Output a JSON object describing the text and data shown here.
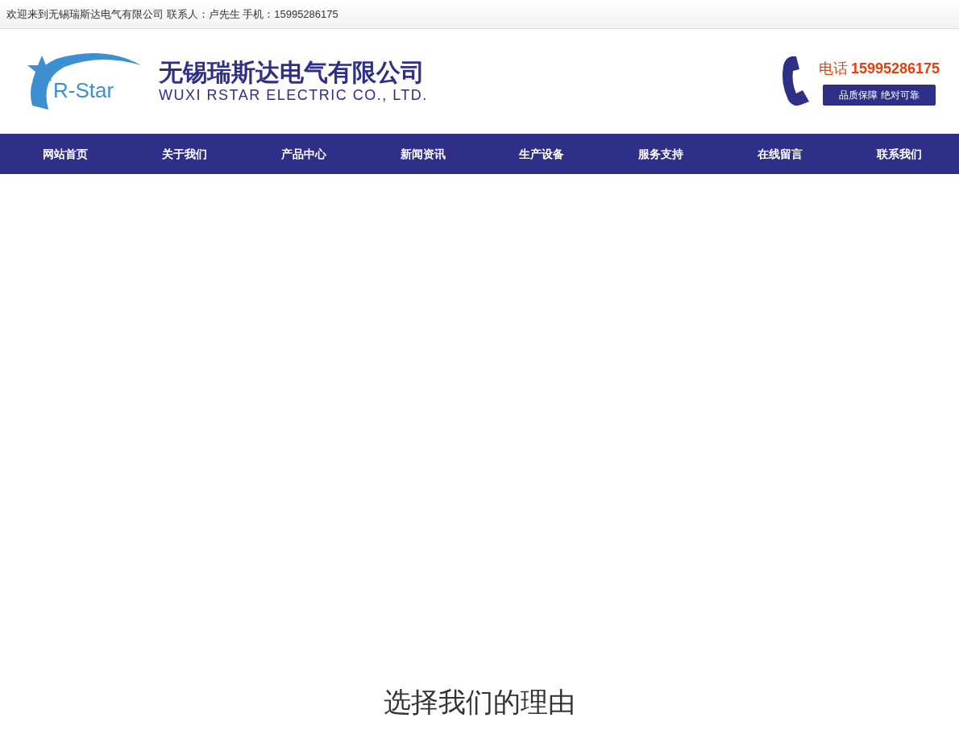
{
  "top_bar": {
    "text": "欢迎来到无锡瑞斯达电气有限公司 联系人：卢先生 手机：15995286175"
  },
  "header": {
    "logo_text": "R-Star",
    "company_name": "无锡瑞斯达电气有限公司",
    "company_name_en": "WUXI RSTAR ELECTRIC CO., LTD.",
    "phone_label": "电话",
    "phone_number": "15995286175",
    "slogan": "品质保障 绝对可靠"
  },
  "nav": {
    "items": [
      "网站首页",
      "关于我们",
      "产品中心",
      "新闻资讯",
      "生产设备",
      "服务支持",
      "在线留言",
      "联系我们"
    ]
  },
  "section": {
    "title": "选择我们的理由"
  }
}
